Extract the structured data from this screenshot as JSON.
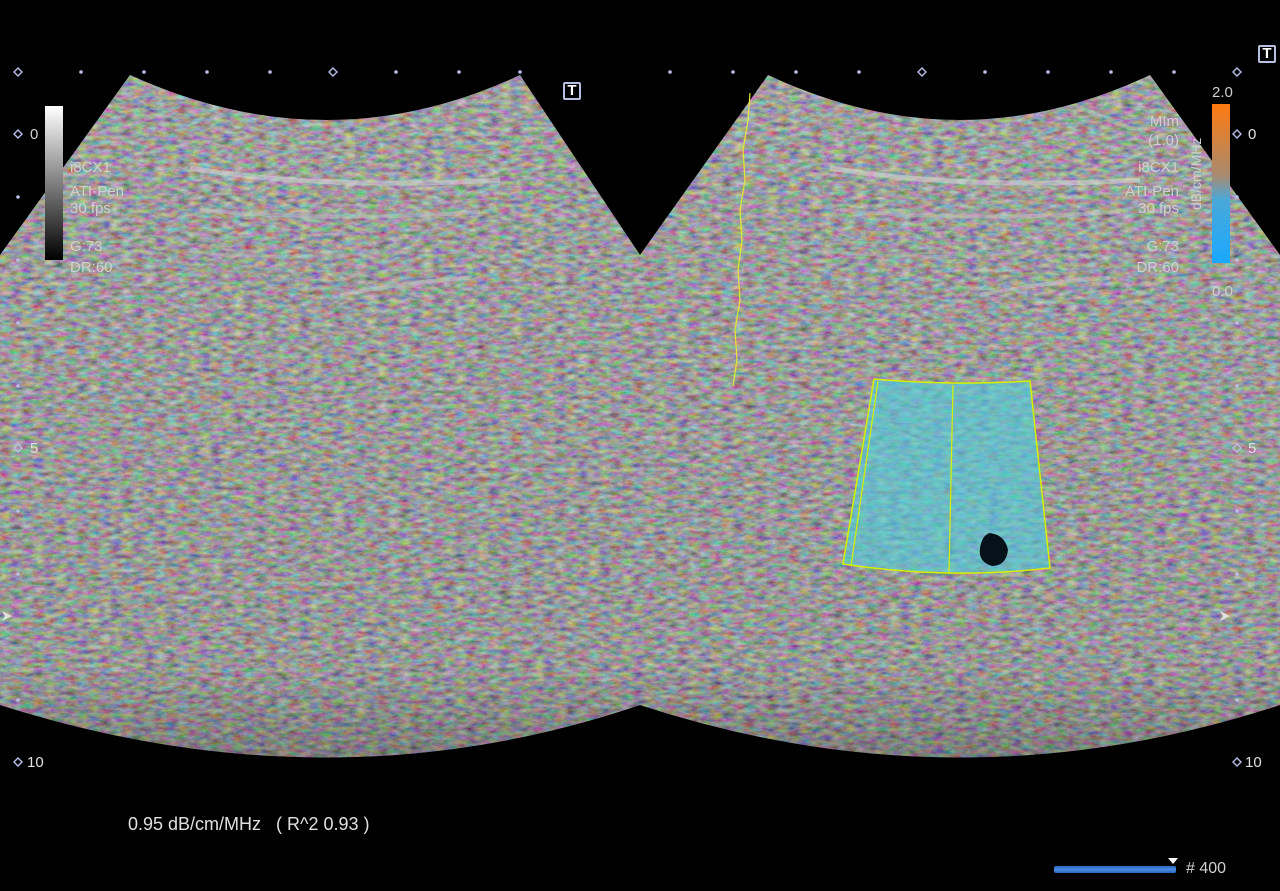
{
  "left_panel": {
    "probe": "i8CX1",
    "mode": "ATI-Pen",
    "frame_rate": "30 fps",
    "gain": "G:73",
    "dynamic_range": "DR:60",
    "grayscale_top_label": "0"
  },
  "right_panel": {
    "mi_label": "MIm",
    "mi_value": "(1.0)",
    "probe": "i8CX1",
    "mode": "ATI-Pen",
    "frame_rate": "30 fps",
    "gain": "G:73",
    "dynamic_range": "DR:60",
    "colorbar": {
      "max_label": "2.0",
      "min_label": "0.0",
      "unit": "dB/cm/MHz",
      "top_color": "#ff7a10",
      "bottom_color": "#1aa8ff"
    },
    "roi_color": "#d8f000",
    "roi_fill": "#4fd0e0"
  },
  "depth_scale": {
    "labels": [
      "0",
      "5",
      "10"
    ]
  },
  "measurement": {
    "result": "0.95 dB/cm/MHz   ( R^2 0.93 )"
  },
  "cine": {
    "frame_label": "# 400",
    "progress_fraction": 1.0
  },
  "icons": {
    "text_tool": "T",
    "text_tool_name": "text-annotation-icon"
  }
}
